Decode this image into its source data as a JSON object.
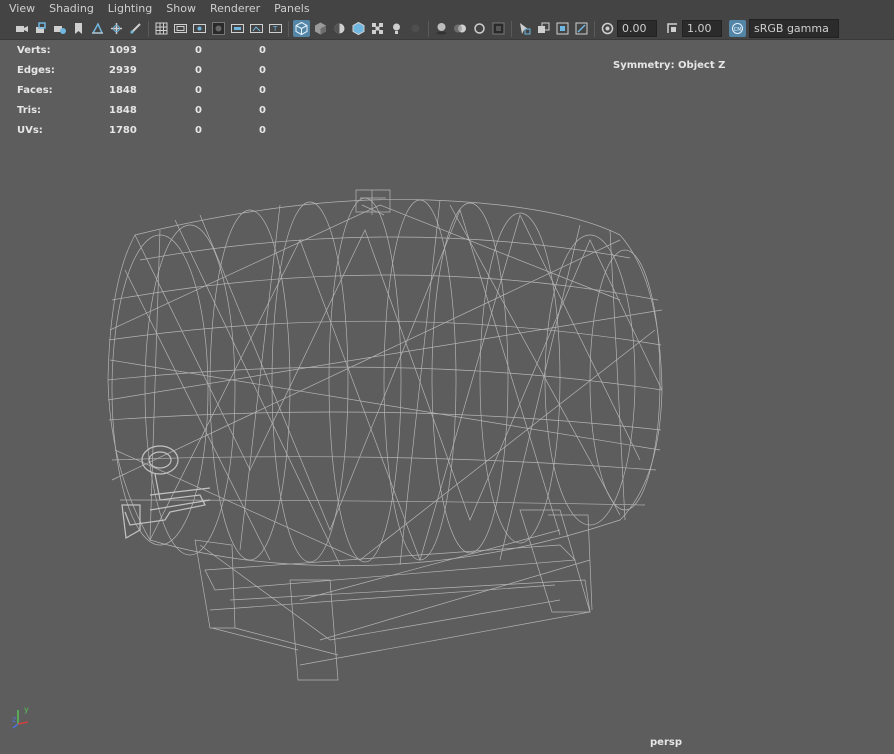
{
  "menu": [
    "View",
    "Shading",
    "Lighting",
    "Show",
    "Renderer",
    "Panels"
  ],
  "toolbar": {
    "exposure_value": "0.00",
    "gamma_value": "1.00",
    "color_space": "sRGB gamma"
  },
  "hud": {
    "rows": [
      {
        "label": "Verts:",
        "values": [
          "1093",
          "0",
          "0"
        ]
      },
      {
        "label": "Edges:",
        "values": [
          "2939",
          "0",
          "0"
        ]
      },
      {
        "label": "Faces:",
        "values": [
          "1848",
          "0",
          "0"
        ]
      },
      {
        "label": "Tris:",
        "values": [
          "1848",
          "0",
          "0"
        ]
      },
      {
        "label": "UVs:",
        "values": [
          "1780",
          "0",
          "0"
        ]
      }
    ],
    "symmetry": "Symmetry: Object Z"
  },
  "camera": "persp",
  "axis_labels": {
    "y": "y",
    "z": "z"
  },
  "colors": {
    "background": "#5d5d5d",
    "wire": "#b8b8b8",
    "active": "#5285a6",
    "axis_x": "#d14040",
    "axis_y": "#58c058",
    "axis_z": "#4a74d8"
  }
}
